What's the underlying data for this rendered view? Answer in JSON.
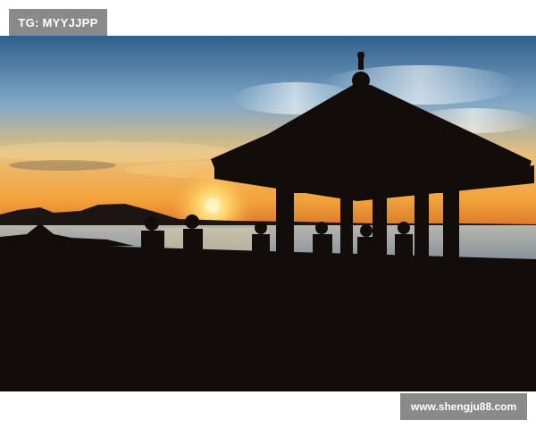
{
  "tag_label": "TG: MYYJJPP",
  "watermark_text": "www.shengju88.com",
  "photo": {
    "subject": "silhouetted pavilion on lakeside boardwalk at sunset",
    "colors": {
      "sky_top": "#2f5f8c",
      "sky_mid": "#7fa7c6",
      "horizon_glow": "#f3b048",
      "water": "#8fa4b8",
      "silhouette": "#120d0b"
    }
  }
}
